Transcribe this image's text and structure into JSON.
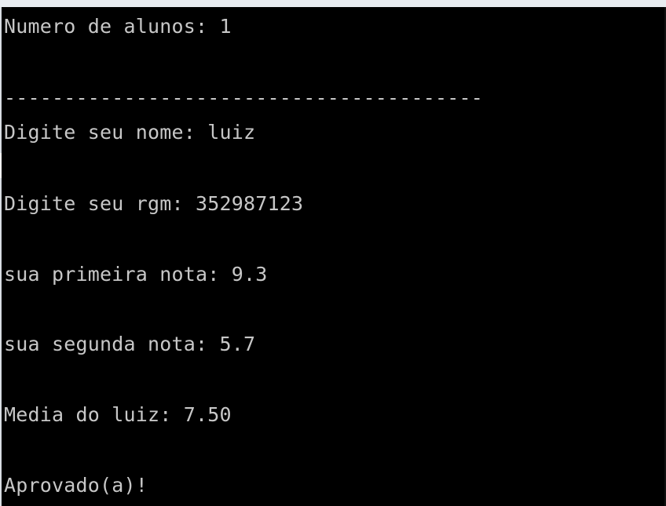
{
  "console": {
    "lines": [
      "Numero de alunos: 1",
      "----------------------------------------",
      "Digite seu nome: luiz",
      "Digite seu rgm: 352987123",
      "sua primeira nota: 9.3",
      "sua segunda nota: 5.7",
      "Media do luiz: 7.50",
      "Aprovado(a)!"
    ]
  },
  "colors": {
    "background": "#000000",
    "text": "#c7c7c7",
    "window_border": "#e9edf1"
  }
}
